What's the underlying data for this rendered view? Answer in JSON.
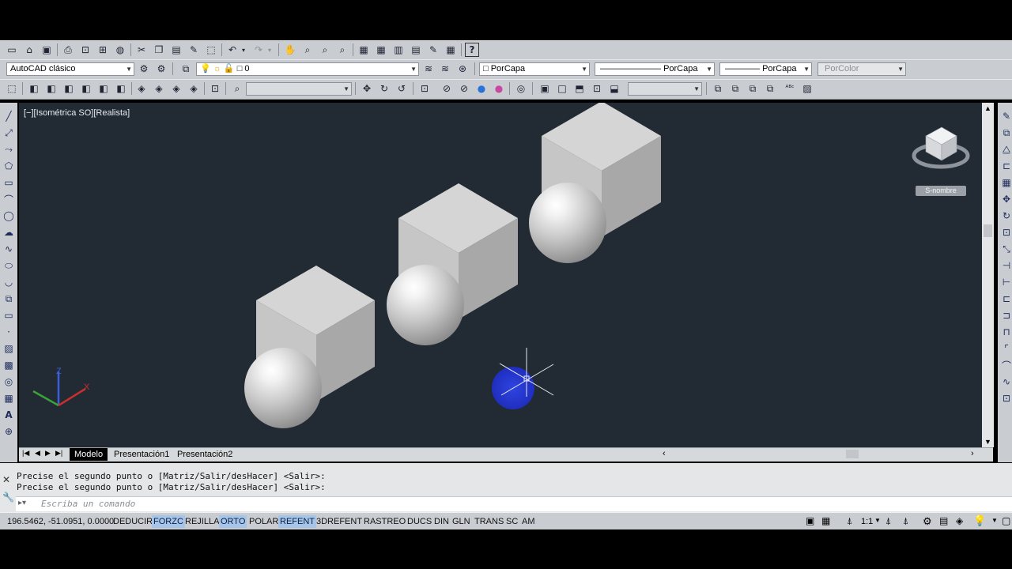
{
  "toolbar2": {
    "workspace": "AutoCAD clásico",
    "layer": "0",
    "color": "PorCapa",
    "linetype": "PorCapa",
    "lineweight": "PorCapa",
    "plotstyle": "PorColor"
  },
  "viewport": {
    "label": "[−][Isométrica SO][Realista]",
    "viewcube_label": "S-nombre",
    "ucs_x": "X",
    "ucs_z": "Z"
  },
  "tabs": [
    "Modelo",
    "Presentación1",
    "Presentación2"
  ],
  "command": {
    "history": [
      "Precise el segundo punto o [Matriz/Salir/desHacer] <Salir>:",
      "Precise el segundo punto o [Matriz/Salir/desHacer] <Salir>:"
    ],
    "placeholder": "Escriba un comando"
  },
  "status": {
    "coords": "196.5462, -51.0951, 0.0000",
    "toggles": [
      "DEDUCIR",
      "FORZC",
      "REJILLA",
      "ORTO",
      "POLAR",
      "REFENT",
      "3DREFENT",
      "RASTREO",
      "DUCS",
      "DIN",
      "GLN",
      "TRANS",
      "SC",
      "AM"
    ],
    "active": [
      "FORZC",
      "ORTO",
      "REFENT"
    ],
    "scale": "1:1"
  },
  "colors": {
    "viewport_bg": "#222a34",
    "toolbar_bg": "#c9cdd2",
    "active_toggle": "#a7c5e8",
    "grip_blue": "#2a3bd1"
  }
}
